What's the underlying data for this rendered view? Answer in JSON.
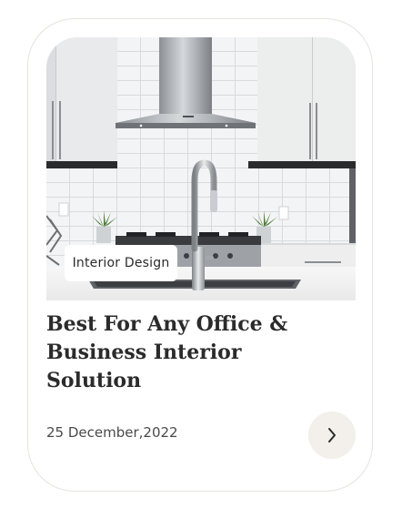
{
  "card": {
    "category_tag": "Interior Design",
    "title": "Best For Any Office & Business Interior Solution",
    "date": "25 December,2022",
    "next_icon": "chevron-right-icon"
  },
  "photo": {
    "subject": "kitchen-interior"
  },
  "colors": {
    "title_text": "#2b2b2b",
    "date_text": "#4a4a4a",
    "button_bg": "#f3efeb",
    "card_border": "#e6e3df"
  }
}
